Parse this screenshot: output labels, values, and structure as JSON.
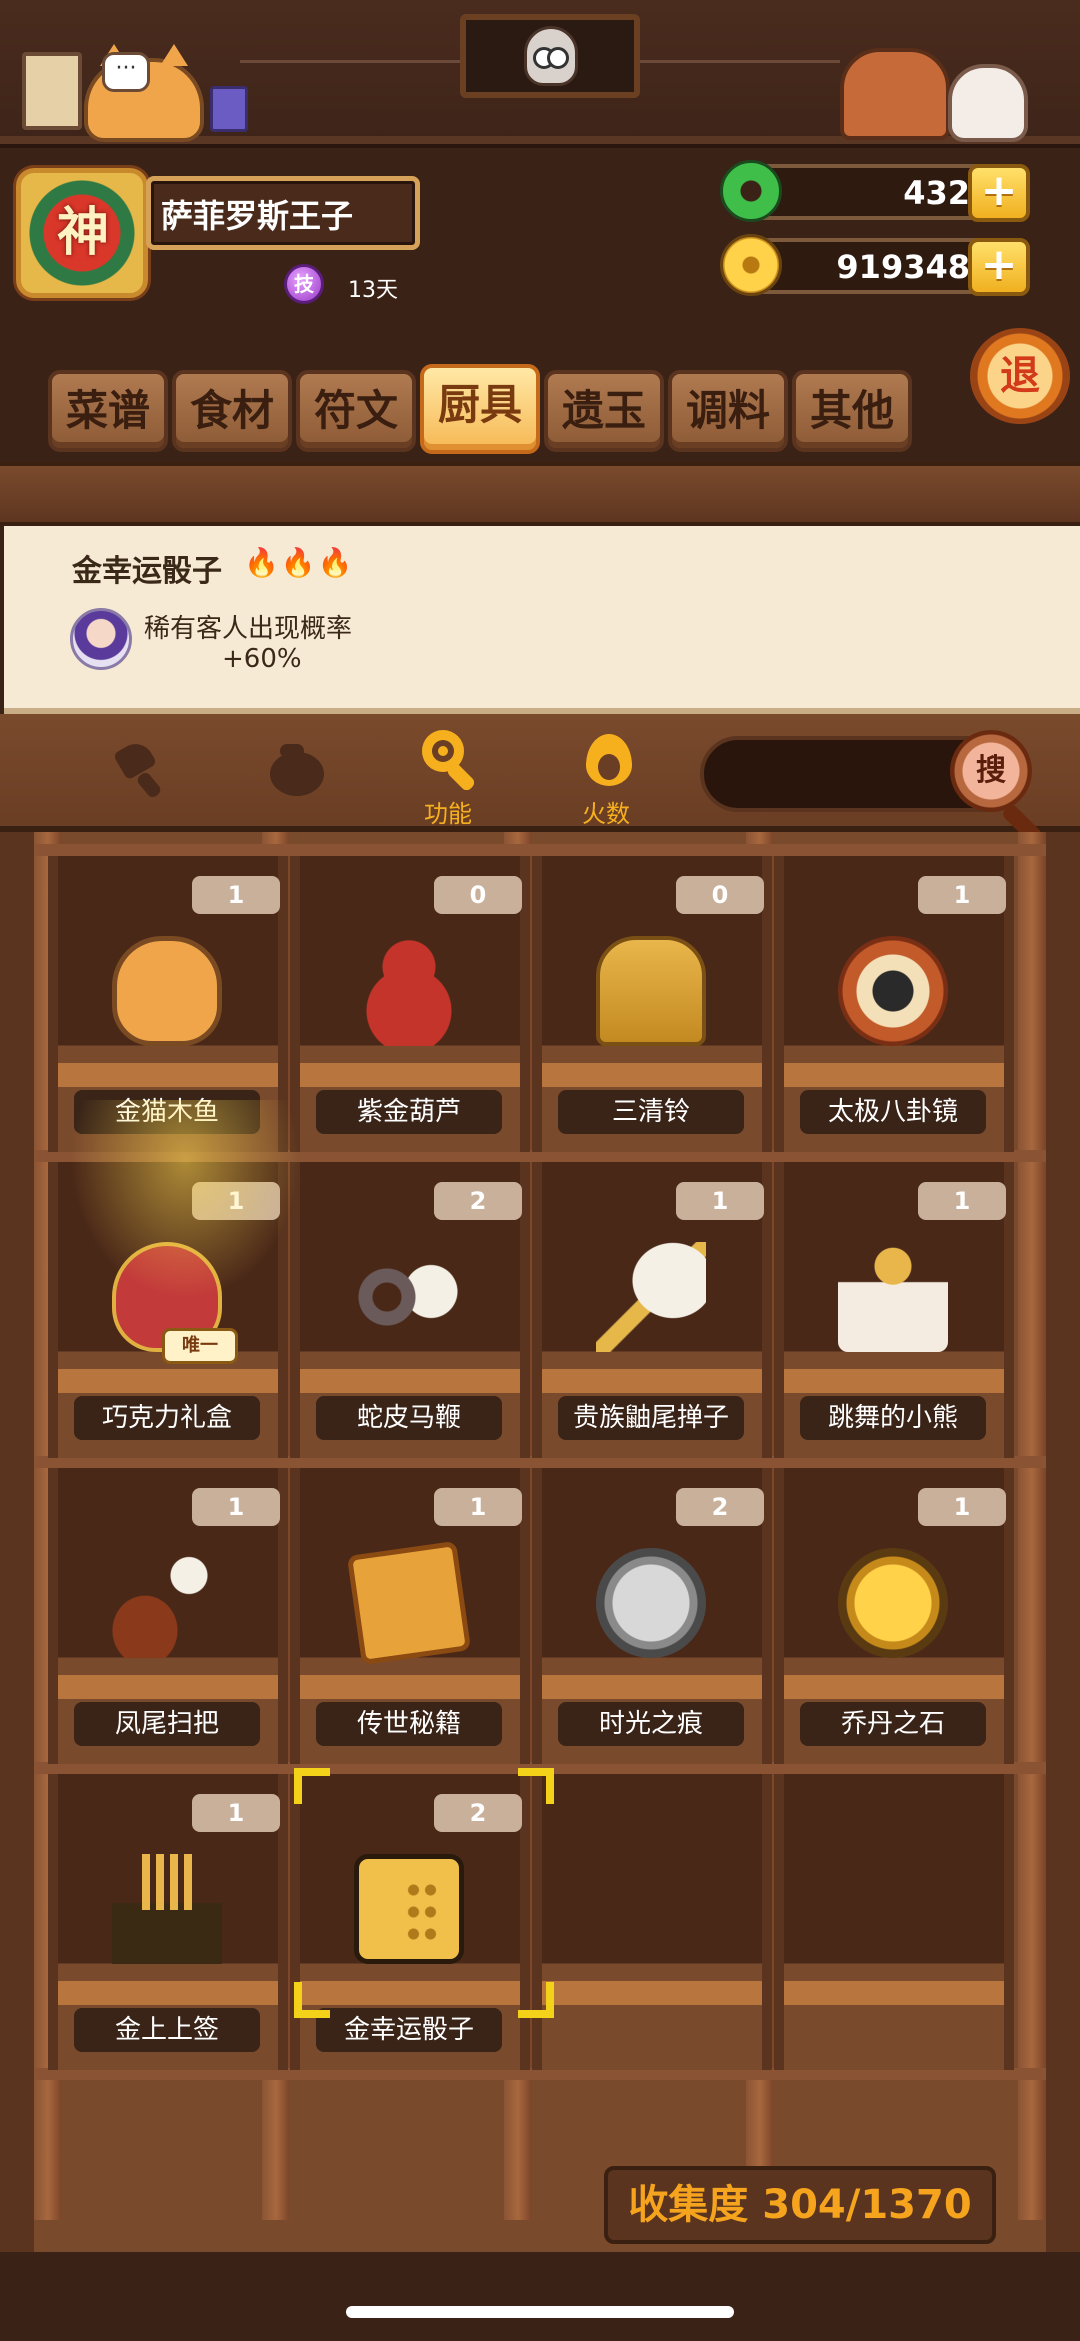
{
  "profile": {
    "avatar_char": "神",
    "name": "萨菲罗斯王子",
    "skill_badge": "技",
    "skill_days": "13天"
  },
  "currency": {
    "jade": "432",
    "coins": "919348",
    "plus": "+"
  },
  "exit_label": "退",
  "tabs": [
    "菜谱",
    "食材",
    "符文",
    "厨具",
    "遗玉",
    "调料",
    "其他"
  ],
  "active_tab": "厨具",
  "selected_item": {
    "title": "金幸运骰子",
    "fire": "🔥🔥🔥",
    "effect_name": "稀有客人出现概率",
    "effect_value": "+60%"
  },
  "filters": {
    "function_label": "功能",
    "fire_label": "火数",
    "search_button": "搜"
  },
  "items": [
    {
      "name": "金猫木鱼",
      "count": "1",
      "icon": "gold-cat-fish-icon"
    },
    {
      "name": "紫金葫芦",
      "count": "0",
      "icon": "gourd-icon"
    },
    {
      "name": "三清铃",
      "count": "0",
      "icon": "bell-icon"
    },
    {
      "name": "太极八卦镜",
      "count": "1",
      "icon": "bagua-mirror-icon"
    },
    {
      "name": "巧克力礼盒",
      "count": "1",
      "icon": "chocolate-box-icon"
    },
    {
      "name": "蛇皮马鞭",
      "count": "2",
      "icon": "horse-whip-icon"
    },
    {
      "name": "贵族鼬尾掸子",
      "count": "1",
      "icon": "duster-icon"
    },
    {
      "name": "跳舞的小熊",
      "count": "1",
      "icon": "dancing-bear-icon"
    },
    {
      "name": "凤尾扫把",
      "count": "1",
      "icon": "phoenix-broom-icon"
    },
    {
      "name": "传世秘籍",
      "count": "1",
      "icon": "secret-book-icon"
    },
    {
      "name": "时光之痕",
      "count": "2",
      "icon": "silver-coin-icon"
    },
    {
      "name": "乔丹之石",
      "count": "1",
      "icon": "gold-coin-icon"
    },
    {
      "name": "金上上签",
      "count": "1",
      "icon": "fortune-sticks-icon"
    },
    {
      "name": "金幸运骰子",
      "count": "2",
      "icon": "gold-dice-icon"
    }
  ],
  "unique_tag": "唯一",
  "collection": {
    "label": "收集度 304/1370",
    "collected": 304,
    "total": 1370
  },
  "colors": {
    "accent": "#f6b01e",
    "selection": "#f4d21a",
    "label_bg": "#3a2418"
  }
}
